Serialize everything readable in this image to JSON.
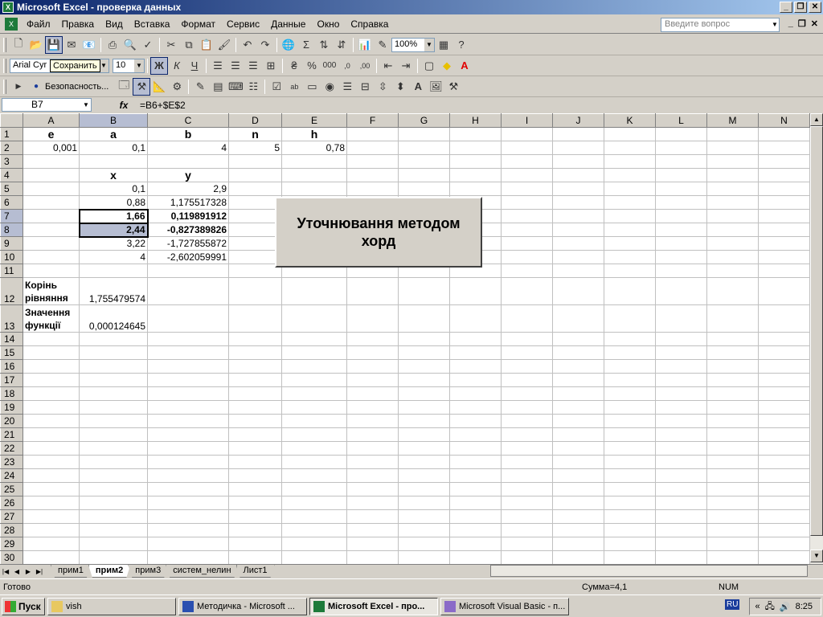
{
  "window": {
    "title": "Microsoft Excel - проверка данных"
  },
  "menu": [
    "Файл",
    "Правка",
    "Вид",
    "Вставка",
    "Формат",
    "Сервис",
    "Данные",
    "Окно",
    "Справка"
  ],
  "ask_placeholder": "Введите вопрос",
  "toolbar": {
    "zoom": "100%",
    "font": "Arial Cyr",
    "font_size": "10",
    "tooltip": "Сохранить",
    "security": "Безопасность..."
  },
  "formula_bar": {
    "cell": "B7",
    "fx": "fx",
    "formula": "=B6+$E$2"
  },
  "columns": [
    "A",
    "B",
    "C",
    "D",
    "E",
    "F",
    "G",
    "H",
    "I",
    "J",
    "K",
    "L",
    "M",
    "N"
  ],
  "cells": {
    "r1": {
      "A": "e",
      "B": "a",
      "C": "b",
      "D": "n",
      "E": "h"
    },
    "r2": {
      "A": "0,001",
      "B": "0,1",
      "C": "4",
      "D": "5",
      "E": "0,78"
    },
    "r4": {
      "B": "x",
      "C": "y"
    },
    "r5": {
      "B": "0,1",
      "C": "2,9"
    },
    "r6": {
      "B": "0,88",
      "C": "1,175517328"
    },
    "r7": {
      "B": "1,66",
      "C": "0,119891912"
    },
    "r8": {
      "B": "2,44",
      "C": "-0,827389826"
    },
    "r9": {
      "B": "3,22",
      "C": "-1,727855872"
    },
    "r10": {
      "B": "4",
      "C": "-2,602059991"
    },
    "r12": {
      "A1": "Корінь",
      "A2": "рівняння",
      "B": "1,755479574"
    },
    "r13": {
      "A1": "Значення",
      "A2": "функції",
      "B": "0,000124645"
    }
  },
  "macro_button": "Уточнювання методом хорд",
  "tabs": [
    "прим1",
    "прим2",
    "прим3",
    "систем_нелин",
    "Лист1"
  ],
  "status": {
    "ready": "Готово",
    "sum": "Сумма=4,1",
    "num": "NUM"
  },
  "taskbar": {
    "start": "Пуск",
    "tasks": [
      "vish",
      "Методичка - Microsoft ...",
      "Microsoft Excel - про...",
      "Microsoft Visual Basic - п..."
    ],
    "lang": "RU",
    "clock": "8:25"
  }
}
